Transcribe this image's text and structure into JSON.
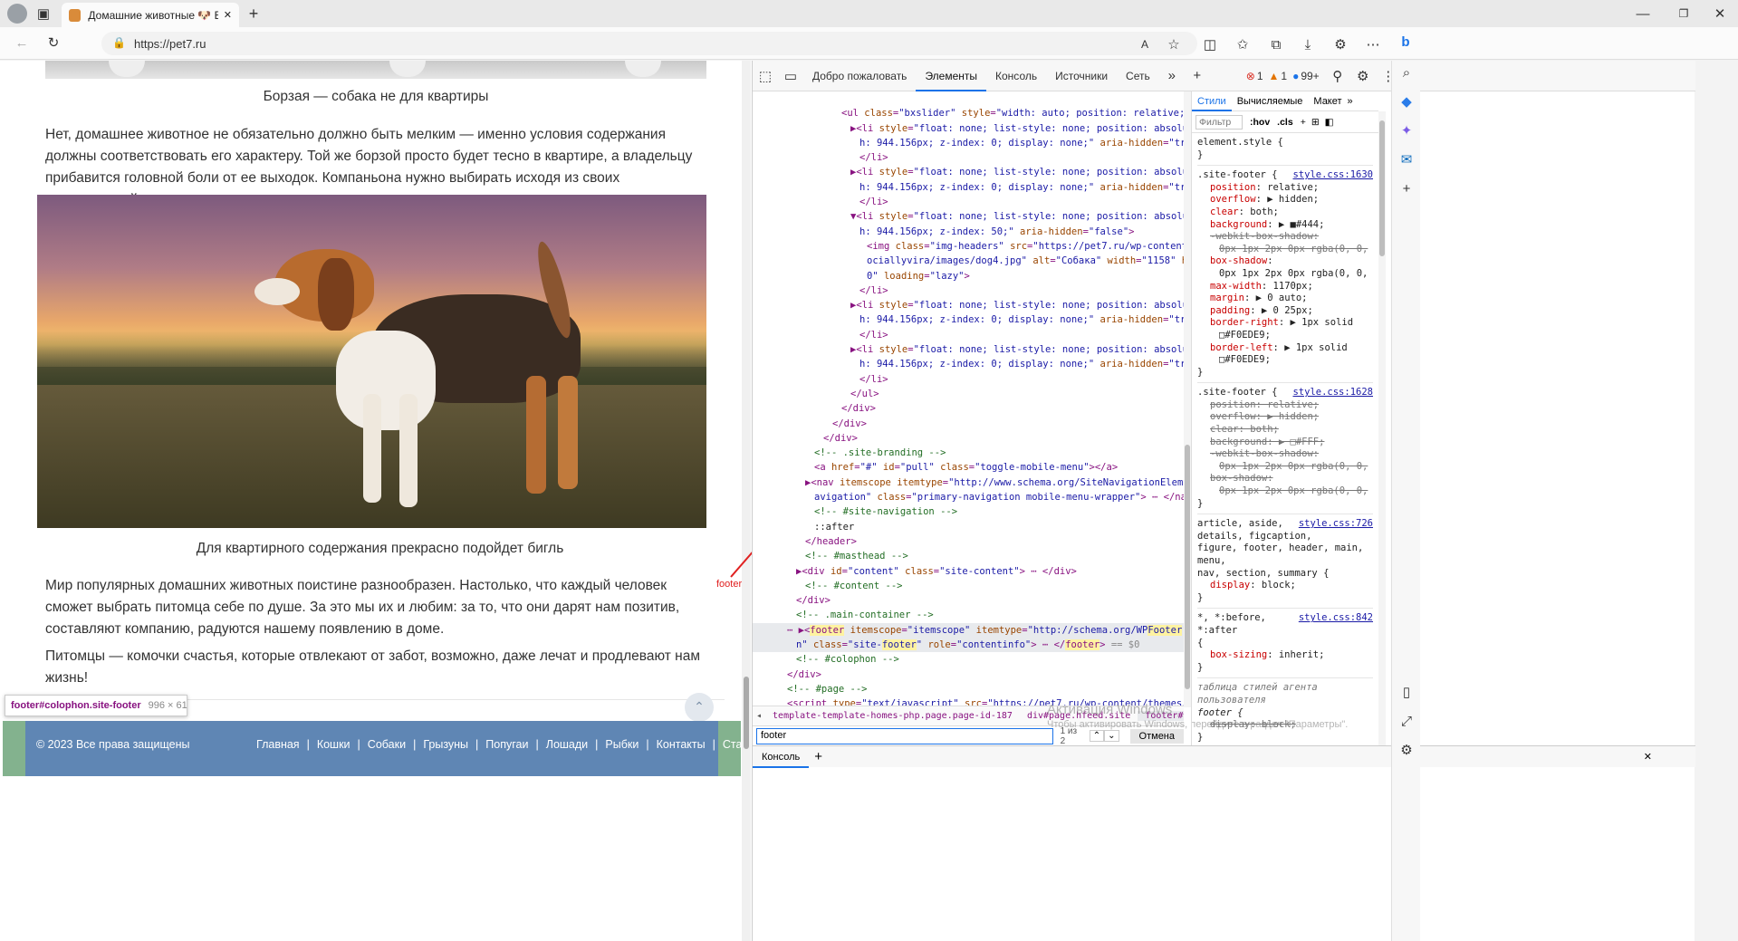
{
  "browser": {
    "tab_title": "Домашние животные 🐶 Все п",
    "url": "https://pet7.ru",
    "close_glyph": "✕",
    "new_tab_glyph": "+"
  },
  "page": {
    "caption_top": "Борзая — собака не для квартиры",
    "para1": "Нет, домашнее животное не обязательно должно быть мелким — именно условия содержания должны соответствовать его характеру. Той же борзой просто будет тесно в квартире, а владельцу прибавится головной боли от ее выходок. Компаньона нужно выбирать исходя из своих возможностей.",
    "caption_dog": "Для квартирного содержания прекрасно подойдет бигль",
    "para2": "Мир популярных домашних животных поистине разнообразен. Настолько, что каждый человек сможет выбрать питомца себе по душе. За это мы их и любим: за то, что они дарят нам позитив, составляют компанию, радуются нашему появлению в доме.",
    "para3": "Питомцы — комочки счастья, которые отвлекают от забот, возможно, даже лечат и продлевают нам жизнь!",
    "tooltip_name": "footer#colophon.site-footer",
    "tooltip_size": "996 × 61",
    "copyright": "© 2023 Все права защищены",
    "footer_links": [
      "Главная",
      "Кошки",
      "Собаки",
      "Грызуны",
      "Попугаи",
      "Лошади",
      "Рыбки",
      "Контакты",
      "Статьи"
    ],
    "annotation": "footer"
  },
  "devtools": {
    "tabs": [
      "Добро пожаловать",
      "Элементы",
      "Консоль",
      "Источники",
      "Сеть"
    ],
    "badges": {
      "errors": "1",
      "warnings": "1",
      "info": "99+"
    },
    "styles_tabs": [
      "Стили",
      "Вычисляемые",
      "Макет"
    ],
    "filter_placeholder": "Фильтр",
    "hov": ":hov",
    "cls": ".cls",
    "breadcrumbs": [
      "template-template-homes-php.page.page-id-187",
      "div#page.hfeed.site",
      "footer#colophon.site-footer"
    ],
    "search_value": "footer",
    "search_count": "1 из 2",
    "cancel_label": "Отмена",
    "console_tab": "Консоль",
    "watermark_line1": "Активация Windows",
    "watermark_line2": "Чтобы активировать Windows, перейдите в раздел \"Параметры\"."
  }
}
